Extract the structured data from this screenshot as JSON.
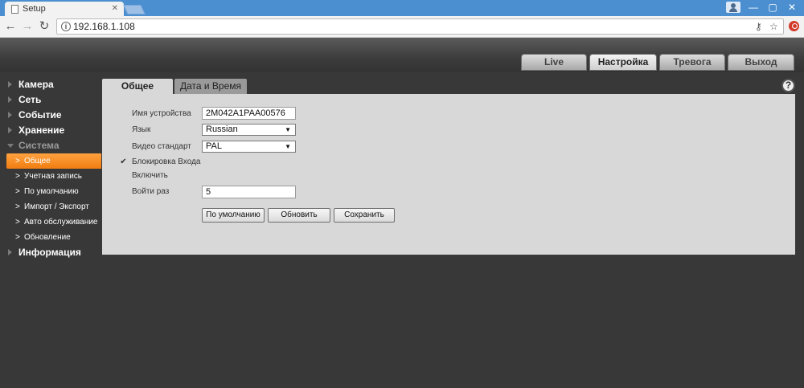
{
  "browser": {
    "tab_title": "Setup",
    "tab_close": "✕",
    "url": "192.168.1.108",
    "window_controls": [
      "—",
      "▢",
      "✕"
    ]
  },
  "main_tabs": [
    {
      "label": "Live",
      "active": false
    },
    {
      "label": "Настройка",
      "active": true
    },
    {
      "label": "Тревога",
      "active": false
    },
    {
      "label": "Выход",
      "active": false
    }
  ],
  "sidebar": {
    "groups": [
      {
        "label": "Камера"
      },
      {
        "label": "Сеть"
      },
      {
        "label": "Событие"
      },
      {
        "label": "Хранение"
      },
      {
        "label": "Система"
      }
    ],
    "system_items": [
      {
        "label": "Общее",
        "active": true
      },
      {
        "label": "Учетная запись"
      },
      {
        "label": "По умолчанию"
      },
      {
        "label": "Импорт / Экспорт"
      },
      {
        "label": "Авто обслуживание"
      },
      {
        "label": "Обновление"
      }
    ],
    "last_group": {
      "label": "Информация"
    },
    "sub_chevron": ">"
  },
  "content_tabs": {
    "general": "Общее",
    "datetime": "Дата и Время"
  },
  "help_icon_glyph": "?",
  "form": {
    "device_name_label": "Имя устройства",
    "device_name_value": "2M042A1PAA00576",
    "language_label": "Язык",
    "language_value": "Russian",
    "video_standard_label": "Видео стандарт",
    "video_standard_value": "PAL",
    "login_lock_label": "Блокировка Входа",
    "login_lock_checked": true,
    "checkbox_glyph": "✔",
    "enable_label": "Включить",
    "login_attempts_label": "Войти раз",
    "login_attempts_value": "5",
    "select_arrow": "▼"
  },
  "buttons": {
    "default": "По умолчанию",
    "refresh": "Обновить",
    "save": "Сохранить"
  }
}
